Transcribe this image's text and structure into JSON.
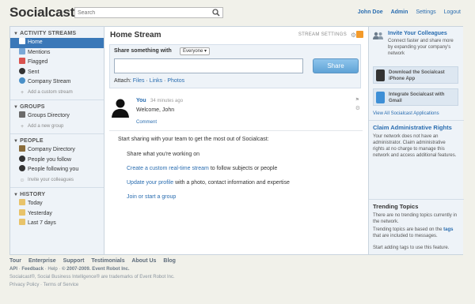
{
  "header": {
    "logo": "Socialcast",
    "search_placeholder": "Search",
    "user_name": "John Doe",
    "admin": "Admin",
    "settings": "Settings",
    "logout": "Logout"
  },
  "sidebar": {
    "activity_head": "ACTIVITY STREAMS",
    "activity_items": [
      {
        "label": "Home",
        "icon": "home-icon"
      },
      {
        "label": "Mentions",
        "icon": "at-icon"
      },
      {
        "label": "Flagged",
        "icon": "flag-icon"
      },
      {
        "label": "Sent",
        "icon": "person-icon"
      },
      {
        "label": "Company Stream",
        "icon": "globe-icon"
      }
    ],
    "add_stream": "Add a custom stream",
    "groups_head": "GROUPS",
    "groups_directory": "Groups Directory",
    "add_group": "Add a new group",
    "people_head": "PEOPLE",
    "people_items": [
      "Company Directory",
      "People you follow",
      "People following you"
    ],
    "invite": "Invite your colleagues",
    "history_head": "HISTORY",
    "history_items": [
      "Today",
      "Yesterday",
      "Last 7 days"
    ]
  },
  "center": {
    "title": "Home Stream",
    "stream_settings": "STREAM SETTINGS",
    "share_label": "Share something with",
    "audience": "Everyone ▾",
    "share_button": "Share",
    "attach_label": "Attach:",
    "attach_files": "Files",
    "attach_links": "Links",
    "attach_photos": "Photos",
    "message": {
      "author": "You",
      "time": "34 minutes ago",
      "body": "Welcome, John",
      "comment": "Comment"
    },
    "onboard_intro": "Start sharing with your team to get the most out of Socialcast:",
    "step1": "Share what you're working on",
    "step2_link": "Create a custom real-time stream",
    "step2_rest": " to follow subjects or people",
    "step3_link": "Update your profile",
    "step3_rest": " with a photo, contact information and expertise",
    "step4_link": "Join or start a group"
  },
  "right": {
    "invite_title": "Invite Your Colleagues",
    "invite_text": "Connect faster and share more by expanding your company's network",
    "iphone_app": "Download the Socialcast iPhone App",
    "gmail": "Integrate Socialcast with Gmail",
    "all_apps": "View All Socialcast Applications",
    "claim_title": "Claim Administrative Rights",
    "claim_text": "Your network does not have an administrator. Claim administrative rights at no charge to manage this network and access additional features.",
    "trending_title": "Trending Topics",
    "trending_text1": "There are no trending topics currently in the network.",
    "trending_text2_a": "Trending topics are based on the ",
    "trending_text2_tags": "tags",
    "trending_text2_b": " that are included to messages.",
    "trending_text3": "Start adding tags to use this feature."
  },
  "footer": {
    "links": [
      "Tour",
      "Enterprise",
      "Support",
      "Testimonials",
      "About Us",
      "Blog"
    ],
    "api": "API",
    "feedback": "Feedback",
    "help": "Help",
    "copyright": "© 2007-2009. Event Robot Inc.",
    "trademark": "Socialcast®, Social Business Intelligence® are trademarks of Event Robot Inc.",
    "privacy": "Privacy Policy",
    "terms": "Terms of Service"
  },
  "colors": {
    "accent": "#2a6db0",
    "active_nav": "#3a78b8",
    "share_button": "#5fa3d6",
    "rss": "#f39a2a"
  }
}
